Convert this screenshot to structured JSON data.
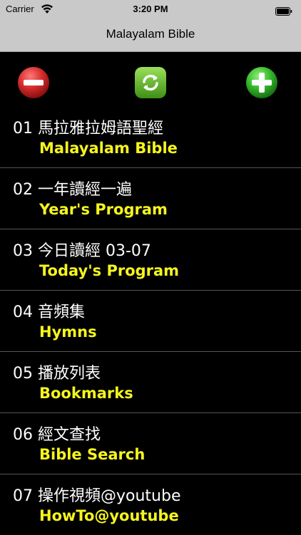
{
  "status_bar": {
    "carrier": "Carrier",
    "time": "3:20 PM",
    "wifi_icon": "wifi-icon",
    "battery_icon": "battery-icon"
  },
  "nav": {
    "title": "Malayalam Bible"
  },
  "toolbar": {
    "remove_icon": "minus-circle-icon",
    "refresh_icon": "refresh-icon",
    "add_icon": "plus-circle-icon"
  },
  "colors": {
    "bar_background": "#c9c9c9",
    "list_background": "#000000",
    "title_text": "#ffffff",
    "subtitle_text": "#f5f51e",
    "remove_red": "#d42a2a",
    "refresh_green": "#6aba2a",
    "add_green": "#34b82a"
  },
  "menu": {
    "items": [
      {
        "title": "01 馬拉雅拉姆語聖經",
        "subtitle": "Malayalam Bible"
      },
      {
        "title": "02 一年讀經一遍",
        "subtitle": "Year's Program"
      },
      {
        "title": "03 今日讀經  03-07",
        "subtitle": "Today's Program"
      },
      {
        "title": "04 音頻集",
        "subtitle": "Hymns"
      },
      {
        "title": "05 播放列表",
        "subtitle": "Bookmarks"
      },
      {
        "title": "06 經文查找",
        "subtitle": "Bible Search"
      },
      {
        "title": "07 操作視頻@youtube",
        "subtitle": "HowTo@youtube"
      }
    ]
  }
}
